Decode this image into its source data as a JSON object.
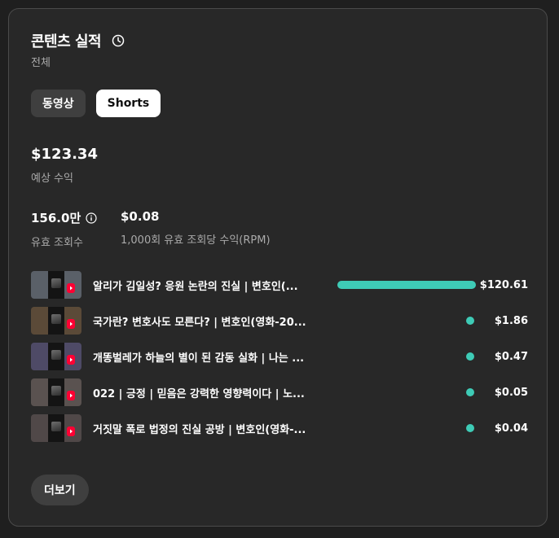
{
  "header": {
    "title": "콘텐츠 실적",
    "subtitle": "전체"
  },
  "tabs": [
    {
      "label": "동영상",
      "active": false
    },
    {
      "label": "Shorts",
      "active": true
    }
  ],
  "revenue": {
    "value": "$123.34",
    "label": "예상 수익"
  },
  "metrics": [
    {
      "value": "156.0만",
      "label": "유효 조회수"
    },
    {
      "value": "$0.08",
      "label": "1,000회 유효 조회당 수익(RPM)"
    }
  ],
  "videos": [
    {
      "title": "알리가 김일성? 응원 논란의 진실 | 변호인(...",
      "amount": "$120.61",
      "share": 1.0
    },
    {
      "title": "국가란? 변호사도 모른다? | 변호인(영화-20...",
      "amount": "$1.86",
      "share": 0.015
    },
    {
      "title": "개똥벌레가 하늘의 별이 된 감동 실화 | 나는 ...",
      "amount": "$0.47",
      "share": 0.004
    },
    {
      "title": "022 | 긍정 | 믿음은 강력한 영향력이다 | 노...",
      "amount": "$0.05",
      "share": 0.0004
    },
    {
      "title": "거짓말 폭로 법정의 진실 공방 | 변호인(영화-...",
      "amount": "$0.04",
      "share": 0.0003
    }
  ],
  "more_button": "더보기",
  "colors": {
    "bar": "#3ecbb6",
    "card": "#282828",
    "accent_badge": "#ff0033"
  }
}
